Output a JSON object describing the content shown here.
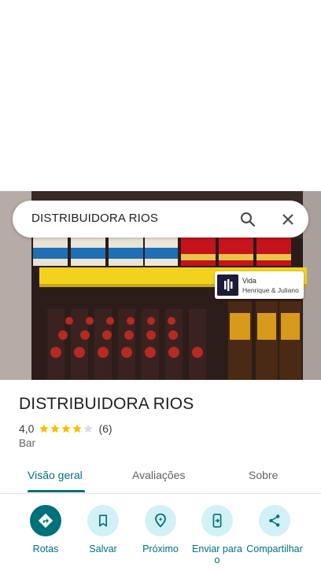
{
  "search": {
    "query": "DISTRIBUIDORA RIOS"
  },
  "music": {
    "title": "Vida",
    "artist": "Henrique & Juliano"
  },
  "place": {
    "name": "DISTRIBUIDORA RIOS",
    "rating": "4,0",
    "rating_stars": 4,
    "review_count": "(6)",
    "category": "Bar"
  },
  "tabs": [
    {
      "label": "Visão geral",
      "active": true
    },
    {
      "label": "Avaliações",
      "active": false
    },
    {
      "label": "Sobre",
      "active": false
    }
  ],
  "actions": [
    {
      "label": "Rotas",
      "icon": "directions-icon"
    },
    {
      "label": "Salvar",
      "icon": "bookmark-icon"
    },
    {
      "label": "Próximo",
      "icon": "nearby-icon"
    },
    {
      "label": "Enviar para o",
      "icon": "send-to-phone-icon"
    },
    {
      "label": "Compartilhar",
      "icon": "share-icon"
    }
  ],
  "colors": {
    "accent": "#00707a",
    "accent_light": "#d2f1f7",
    "star": "#fbbc04"
  }
}
